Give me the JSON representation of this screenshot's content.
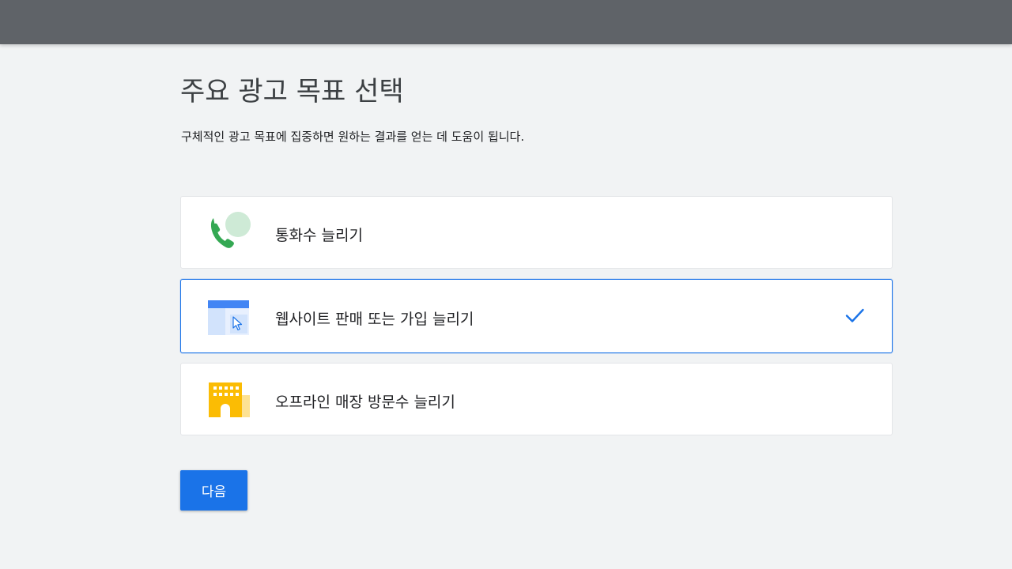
{
  "header": {
    "title": "주요 광고 목표 선택",
    "description": "구체적인 광고 목표에 집중하면 원하는 결과를 얻는 데 도움이 됩니다."
  },
  "options": [
    {
      "label": "통화수 늘리기",
      "icon": "phone-call-icon",
      "selected": false
    },
    {
      "label": "웹사이트 판매 또는 가입 늘리기",
      "icon": "website-cursor-icon",
      "selected": true
    },
    {
      "label": "오프라인 매장 방문수 늘리기",
      "icon": "store-building-icon",
      "selected": false
    }
  ],
  "actions": {
    "next_label": "다음"
  },
  "colors": {
    "accent": "#1a73e8",
    "topbar": "#5f6368",
    "background": "#f1f3f4",
    "phone_green": "#34a853",
    "store_yellow": "#fbbc04"
  }
}
